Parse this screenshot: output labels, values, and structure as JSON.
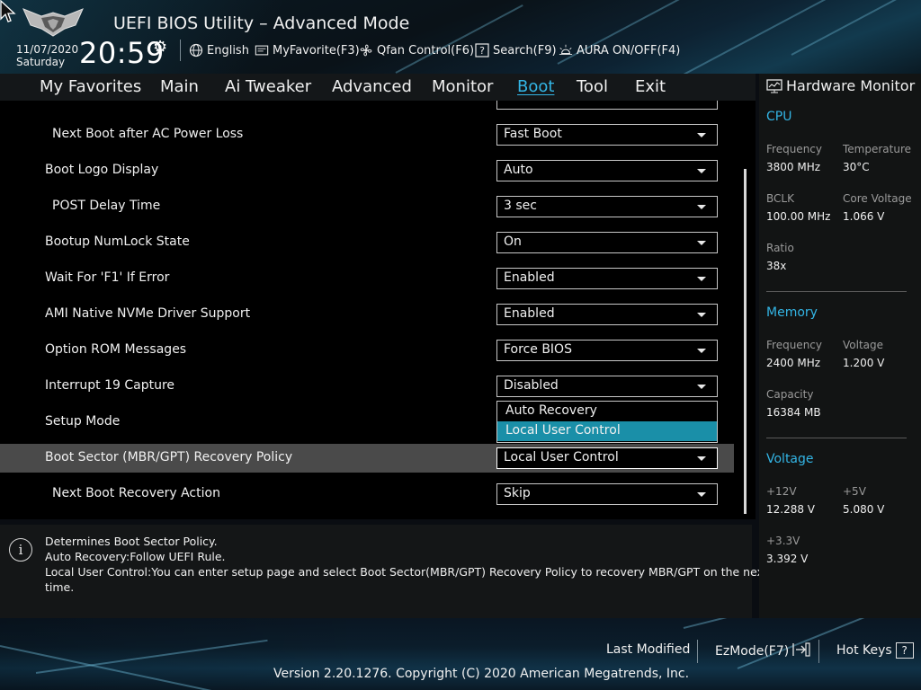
{
  "header": {
    "app_title": "UEFI BIOS Utility – Advanced Mode",
    "date": "11/07/2020",
    "day": "Saturday",
    "time": "20:59",
    "buttons": [
      {
        "label": "English",
        "icon": "globe-icon"
      },
      {
        "label": "MyFavorite(F3)",
        "icon": "favorite-icon"
      },
      {
        "label": "Qfan Control(F6)",
        "icon": "fan-icon"
      },
      {
        "label": "Search(F9)",
        "icon": "search-icon"
      },
      {
        "label": "AURA ON/OFF(F4)",
        "icon": "aura-icon"
      }
    ]
  },
  "tabs": [
    {
      "label": "My Favorites",
      "active": false
    },
    {
      "label": "Main",
      "active": false
    },
    {
      "label": "Ai Tweaker",
      "active": false
    },
    {
      "label": "Advanced",
      "active": false
    },
    {
      "label": "Monitor",
      "active": false
    },
    {
      "label": "Boot",
      "active": true
    },
    {
      "label": "Tool",
      "active": false
    },
    {
      "label": "Exit",
      "active": false
    }
  ],
  "settings": [
    {
      "label": "Next Boot after AC Power Loss",
      "value": "Fast Boot",
      "indent": true
    },
    {
      "label": "Boot Logo Display",
      "value": "Auto",
      "indent": false
    },
    {
      "label": "POST Delay Time",
      "value": "3 sec",
      "indent": true
    },
    {
      "label": "Bootup NumLock State",
      "value": "On",
      "indent": false
    },
    {
      "label": "Wait For 'F1' If Error",
      "value": "Enabled",
      "indent": false
    },
    {
      "label": "AMI Native NVMe Driver Support",
      "value": "Enabled",
      "indent": false
    },
    {
      "label": "Option ROM Messages",
      "value": "Force BIOS",
      "indent": false
    },
    {
      "label": "Interrupt 19 Capture",
      "value": "Disabled",
      "indent": false
    },
    {
      "label": "Setup Mode",
      "value": "",
      "indent": false
    },
    {
      "label": "Boot Sector (MBR/GPT) Recovery Policy",
      "value": "Local User Control",
      "indent": false,
      "selected": true
    },
    {
      "label": "Next Boot Recovery Action",
      "value": "Skip",
      "indent": true
    }
  ],
  "dropdown": {
    "options": [
      "Auto Recovery",
      "Local User Control"
    ],
    "highlighted": "Local User Control"
  },
  "help": {
    "lines": [
      "Determines Boot Sector Policy.",
      " Auto Recovery:Follow UEFI Rule.",
      " Local User Control:You can enter setup page and select Boot Sector(MBR/GPT) Recovery Policy to recovery MBR/GPT on the next boot",
      "time."
    ]
  },
  "hardware_monitor": {
    "title": "Hardware Monitor",
    "cpu": {
      "title": "CPU",
      "frequency_label": "Frequency",
      "frequency": "3800 MHz",
      "temperature_label": "Temperature",
      "temperature": "30°C",
      "bclk_label": "BCLK",
      "bclk": "100.00 MHz",
      "core_voltage_label": "Core Voltage",
      "core_voltage": "1.066 V",
      "ratio_label": "Ratio",
      "ratio": "38x"
    },
    "memory": {
      "title": "Memory",
      "frequency_label": "Frequency",
      "frequency": "2400 MHz",
      "voltage_label": "Voltage",
      "voltage": "1.200 V",
      "capacity_label": "Capacity",
      "capacity": "16384 MB"
    },
    "voltage": {
      "title": "Voltage",
      "v12_label": "+12V",
      "v12": "12.288 V",
      "v5_label": "+5V",
      "v5": "5.080 V",
      "v33_label": "+3.3V",
      "v33": "3.392 V"
    }
  },
  "footer": {
    "last_modified": "Last Modified",
    "ezmode": "EzMode(F7)",
    "hotkeys": "Hot Keys",
    "hotkeys_key": "?",
    "version": "Version 2.20.1276. Copyright (C) 2020 American Megatrends, Inc."
  },
  "colors": {
    "accent": "#33b5e5",
    "highlight": "#1a8fa8",
    "selected_row": "#4a4a4a"
  }
}
